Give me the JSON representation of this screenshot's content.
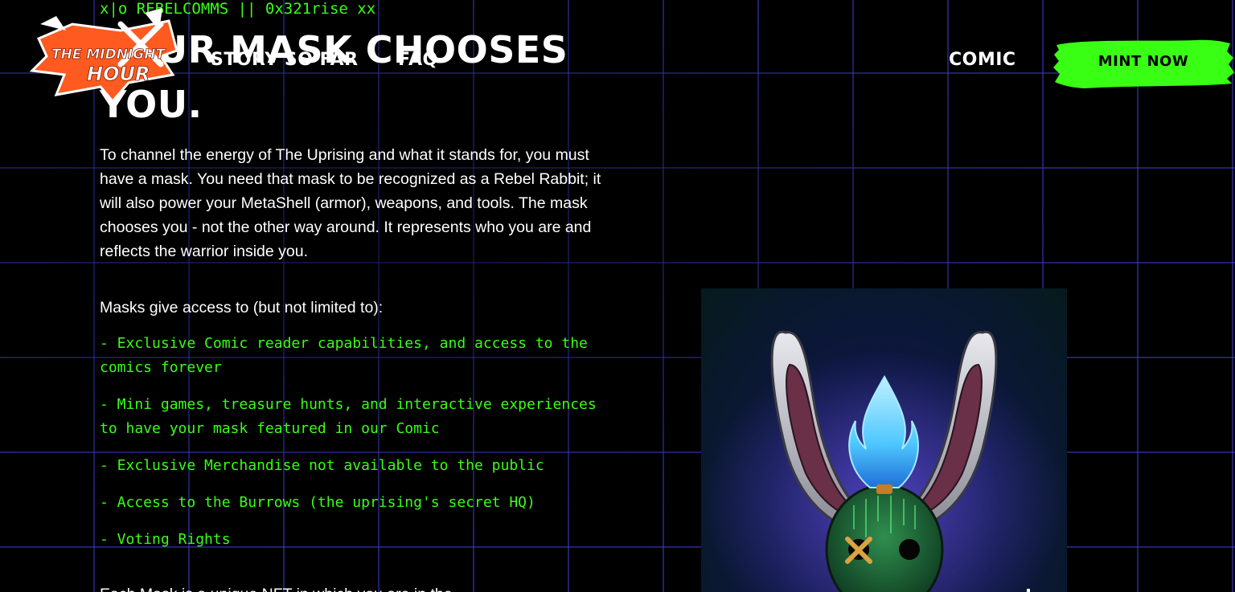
{
  "brand": {
    "logo_text_line1": "THE MIDNIGHT",
    "logo_text_line2": "HOUR",
    "brand_color": "#ff5a1f"
  },
  "nav": {
    "story": "STORY SO FAR",
    "faq": "FAQ",
    "comic": "COMIC",
    "mint": "MINT NOW",
    "mint_color": "#39ff14"
  },
  "content": {
    "comms": "x|o REBELCOMMS || 0x321rise xx",
    "headline": "YOUR MASK CHOOSES YOU.",
    "intro": "To channel the energy of The Uprising and what it stands for, you must have a mask. You need that mask to be recognized as a Rebel Rabbit; it will also power your MetaShell (armor), weapons, and tools. The mask chooses you - not the other way around. It represents who you are and reflects the warrior inside you.",
    "masks_intro": "Masks give access to (but not limited to):",
    "perks": [
      "- Exclusive Comic reader capabilities, and access to the comics forever",
      "- Mini games, treasure hunts, and interactive experiences to have your mask featured in our Comic",
      "- Exclusive Merchandise not available to the public",
      "- Access to the Burrows (the uprising's secret HQ)",
      "- Voting Rights"
    ],
    "cutoff": "Each Mask is a unique NFT in which you are in the",
    "accent_color": "#39ff14"
  },
  "artwork": {
    "subject": "rebel-rabbit-mask",
    "flame_color": "#4fc8ff",
    "mask_color": "#1f6b3a"
  }
}
